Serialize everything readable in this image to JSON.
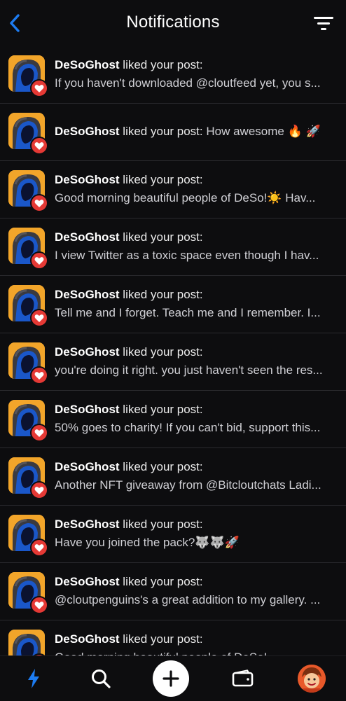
{
  "header": {
    "title": "Notifications"
  },
  "colors": {
    "accent": "#1d7cf2",
    "heart": "#e53935",
    "avatar_bg": "#f2a52a"
  },
  "notifications": [
    {
      "user": "DeSoGhost",
      "action": "liked your post:",
      "post": "If you haven't downloaded @cloutfeed yet, you s..."
    },
    {
      "user": "DeSoGhost",
      "action": "liked your post:",
      "post": "How awesome 🔥 🚀"
    },
    {
      "user": "DeSoGhost",
      "action": "liked your post:",
      "post": "Good morning beautiful people of DeSo!☀️  Hav..."
    },
    {
      "user": "DeSoGhost",
      "action": "liked your post:",
      "post": "I view Twitter as a toxic space even though I hav..."
    },
    {
      "user": "DeSoGhost",
      "action": "liked your post:",
      "post": "Tell me and I forget. Teach me and I remember. I..."
    },
    {
      "user": "DeSoGhost",
      "action": "liked your post:",
      "post": "you're doing it right. you just haven't seen the res..."
    },
    {
      "user": "DeSoGhost",
      "action": "liked your post:",
      "post": "50% goes to charity!  If you can't bid, support this..."
    },
    {
      "user": "DeSoGhost",
      "action": "liked your post:",
      "post": "Another NFT giveaway from @Bitcloutchats Ladi..."
    },
    {
      "user": "DeSoGhost",
      "action": "liked your post:",
      "post": "Have you joined the pack?🐺🐺🚀"
    },
    {
      "user": "DeSoGhost",
      "action": "liked your post:",
      "post": "@cloutpenguins's a great addition to my gallery.  ..."
    },
    {
      "user": "DeSoGhost",
      "action": "liked your post:",
      "post": "Good morning beautiful people of DeSo!"
    }
  ],
  "bottom_nav": {
    "icons": [
      "lightning-icon",
      "search-icon",
      "plus-icon",
      "wallet-icon",
      "profile-avatar"
    ]
  }
}
